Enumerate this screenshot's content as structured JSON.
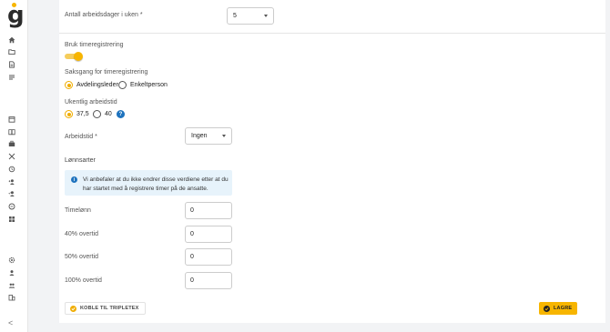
{
  "app": {
    "logo_letter": "g"
  },
  "sidebar": {
    "icons": [
      "home-icon",
      "folder-icon",
      "document-icon",
      "list-icon",
      "calendar-icon",
      "book-icon",
      "briefcase-icon",
      "tools-icon",
      "history-icon",
      "user-add-icon",
      "user-check-icon",
      "archive-icon",
      "grid-icon",
      "settings-icon",
      "person-icon",
      "group-icon",
      "company-icon"
    ],
    "collapse_glyph": "<"
  },
  "form": {
    "workdays": {
      "label": "Antall arbeidsdager i uken *",
      "value": "5"
    },
    "time_tracking": {
      "label": "Bruk timeregistrering",
      "enabled": true
    },
    "workflow": {
      "label": "Saksgang for timeregistrering",
      "options": [
        "Avdelingsleder",
        "Enkeltperson"
      ],
      "selected": "Avdelingsleder"
    },
    "weekly_hours": {
      "label": "Ukentlig arbeidstid",
      "options": [
        "37,5",
        "40"
      ],
      "selected": "37,5",
      "help_glyph": "?"
    },
    "worktime": {
      "label": "Arbeidstid *",
      "value": "Ingen"
    },
    "wage_types": {
      "title": "Lønnsarter",
      "info_glyph": "i",
      "info": "Vi anbefaler at du ikke endrer disse verdiene etter at du har startet med å registrere timer på de ansatte.",
      "rows": [
        {
          "label": "Timelønn",
          "value": "0"
        },
        {
          "label": "40% overtid",
          "value": "0"
        },
        {
          "label": "50% overtid",
          "value": "0"
        },
        {
          "label": "100% overtid",
          "value": "0"
        }
      ]
    }
  },
  "actions": {
    "connect_label": "KOBLE TIL TRIPLETEX",
    "save_label": "LAGRE"
  },
  "colors": {
    "accent": "#f7b500",
    "info_bg": "#e7f3fb",
    "info_icon": "#1e73be",
    "page_bg": "#f2f3f5"
  }
}
